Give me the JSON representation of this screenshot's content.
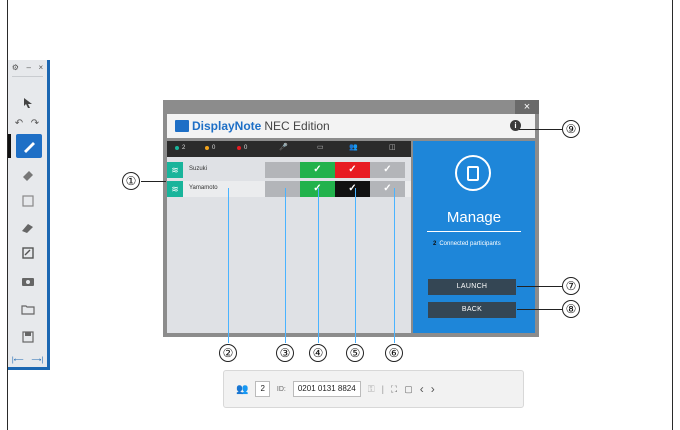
{
  "toolbar": {
    "top_icons": [
      "settings-icon",
      "minimize-icon",
      "close-icon"
    ],
    "tools": [
      "select-tool",
      "undo-icon",
      "redo-icon",
      "pen-tool",
      "eraser-tool",
      "notes-tool",
      "highlighter-tool",
      "whiteboard-tool",
      "camera-tool",
      "folder-tool",
      "save-tool"
    ],
    "selected_tool": "pen-tool"
  },
  "window": {
    "close_label": "×",
    "app_name": "DisplayNote",
    "edition": "NEC Edition",
    "info_label": "i"
  },
  "status": {
    "green_count": "2",
    "orange_count": "0",
    "red_count": "0"
  },
  "participants": [
    {
      "name": "Suzuki"
    },
    {
      "name": "Yamamoto"
    }
  ],
  "panel": {
    "title": "Manage",
    "connected_count": "2",
    "connected_label": "Connected participants",
    "launch_label": "LAUNCH",
    "back_label": "BACK"
  },
  "callouts": {
    "c1": "①",
    "c2": "②",
    "c3": "③",
    "c4": "④",
    "c5": "⑤",
    "c6": "⑥",
    "c7": "⑦",
    "c8": "⑧",
    "c9": "⑨"
  },
  "bottombar": {
    "count": "2",
    "id_label": "ID:",
    "id_value": "0201 0131 8824"
  },
  "colors": {
    "accent": "#1e86d9",
    "green": "#22b24c",
    "red": "#e81b22",
    "teal": "#19b49b"
  }
}
